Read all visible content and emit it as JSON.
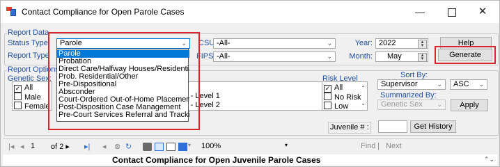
{
  "window": {
    "title": "Contact Compliance for Open Parole Cases",
    "min": "—",
    "max": "",
    "close": "✕"
  },
  "report_data": {
    "group_label": "Report Data",
    "status_type_label": "Status Type:",
    "status_type_value": "Parole",
    "report_type_label": "Report Type",
    "csu_label": "CSU:",
    "csu_value": "-All-",
    "fips_label": "FIPS:",
    "fips_value": "-All-",
    "year_label": "Year:",
    "year_value": "2022",
    "month_label": "Month:",
    "month_value": "May",
    "help_button": "Help",
    "generate_button": "Generate"
  },
  "status_dropdown": {
    "items": [
      "Parole",
      "Probation",
      "Direct Care/Halfway Houses/Residential-Parole",
      "Prob. Residential/Other",
      "Pre-Dispositional",
      "Absconder",
      "Court-Ordered Out-of-Home Placement",
      "Post-Disposition Case Management",
      "Pre-Court Services Referral and Tracking"
    ],
    "selected_index": 0
  },
  "report_options": {
    "group_label": "Report Options",
    "genetic_sex_label": "Genetic Sex:",
    "genetic_sex_items": [
      {
        "label": "All",
        "checked": true
      },
      {
        "label": "Male",
        "checked": false
      },
      {
        "label": "Female",
        "checked": false
      }
    ],
    "level_items": [
      "le - Level 1",
      "le - Level 2"
    ],
    "risk_level_label": "Risk Level",
    "risk_items": [
      {
        "label": "All",
        "checked": true
      },
      {
        "label": "No Risk",
        "checked": false
      },
      {
        "label": "Low",
        "checked": false
      }
    ],
    "sort_by_label": "Sort By:",
    "sort_by_value": "Supervisor",
    "sort_order_value": "ASC",
    "summarized_by_label": "Summarized By:",
    "summarized_by_value": "Genetic Sex",
    "apply_button": "Apply",
    "juvenile_label": "Juvenile # :",
    "juvenile_value": "",
    "get_history_button": "Get History"
  },
  "report_toolbar": {
    "current_page": "1",
    "of_pages": "of 2 ▸",
    "zoom": "100%",
    "find_label": "Find",
    "separator": "|",
    "next_label": "Next"
  },
  "report": {
    "heading": "Contact Compliance for Open Juvenile Parole  Cases"
  }
}
